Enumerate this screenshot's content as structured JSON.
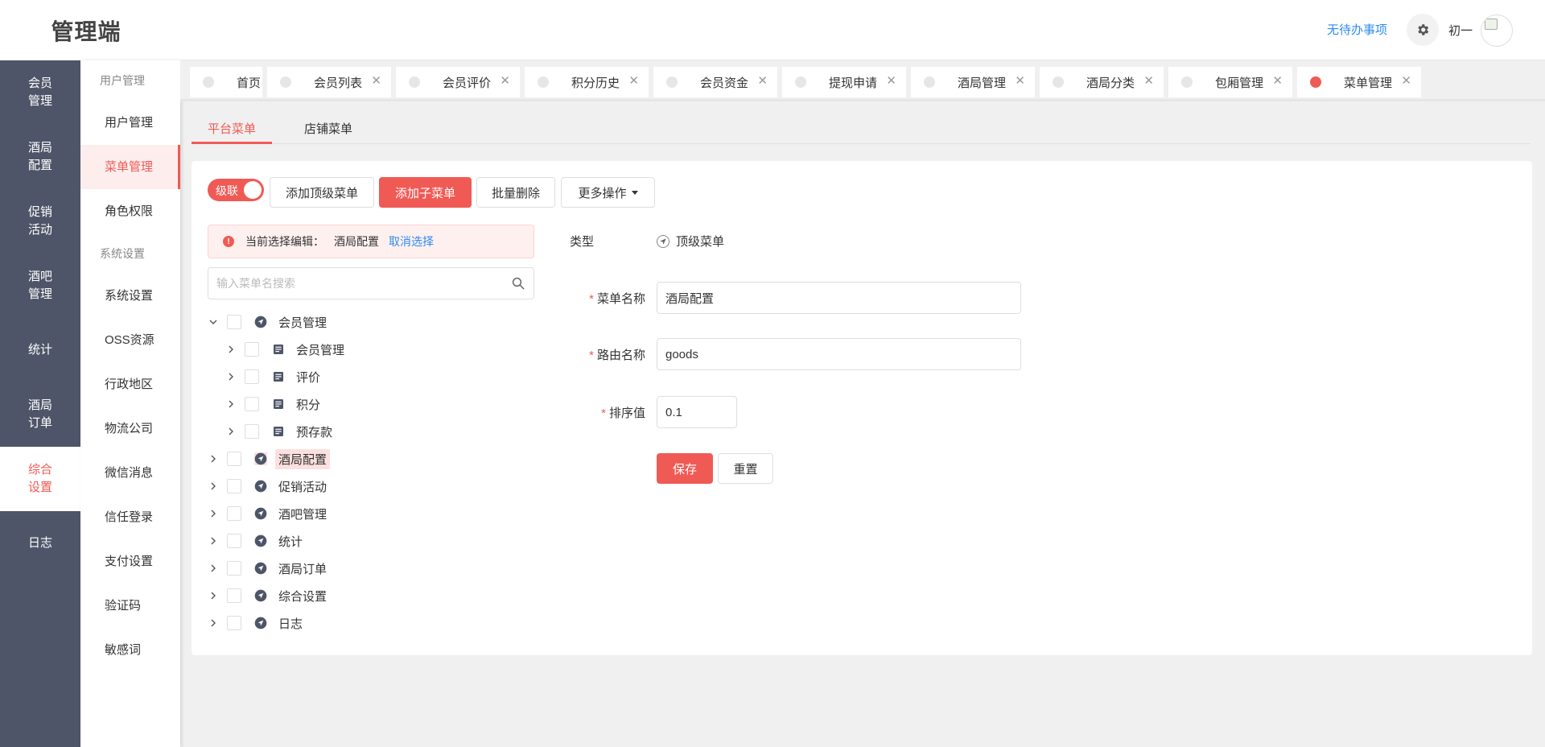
{
  "app": {
    "title": "管理端"
  },
  "nav_primary": [
    {
      "label": "会员管理",
      "active": false
    },
    {
      "label": "酒局配置",
      "active": false
    },
    {
      "label": "促销活动",
      "active": false
    },
    {
      "label": "酒吧管理",
      "active": false
    },
    {
      "label": "统计",
      "active": false
    },
    {
      "label": "酒局订单",
      "active": false
    },
    {
      "label": "综合设置",
      "active": true
    },
    {
      "label": "日志",
      "active": false
    }
  ],
  "nav_secondary": {
    "group_user": "用户管理",
    "user_items": [
      "用户管理",
      "菜单管理",
      "角色权限"
    ],
    "group_system": "系统设置",
    "system_items": [
      "系统设置",
      "OSS资源",
      "行政地区",
      "物流公司",
      "微信消息",
      "信任登录",
      "支付设置",
      "验证码",
      "敏感词"
    ],
    "active": "菜单管理"
  },
  "header": {
    "todo": "无待办事项",
    "username": "初一",
    "gear_icon": "gear-icon"
  },
  "tabs": [
    {
      "label": "首页",
      "closable": false
    },
    {
      "label": "会员列表",
      "closable": true
    },
    {
      "label": "会员评价",
      "closable": true
    },
    {
      "label": "积分历史",
      "closable": true
    },
    {
      "label": "会员资金",
      "closable": true
    },
    {
      "label": "提现申请",
      "closable": true
    },
    {
      "label": "酒局管理",
      "closable": true
    },
    {
      "label": "酒局分类",
      "closable": true
    },
    {
      "label": "包厢管理",
      "closable": true
    },
    {
      "label": "菜单管理",
      "closable": true,
      "active": true
    }
  ],
  "close_glyph": "✕",
  "content_tabs": {
    "platform": "平台菜单",
    "shop": "店铺菜单"
  },
  "toolbar": {
    "switch_label": "级联",
    "add_top": "添加顶级菜单",
    "add_child": "添加子菜单",
    "batch_delete": "批量删除",
    "more": "更多操作"
  },
  "alert": {
    "current_label": "当前选择编辑：",
    "selected": "酒局配置",
    "cancel": "取消选择"
  },
  "search": {
    "placeholder": "输入菜单名搜索"
  },
  "tree": [
    {
      "label": "会员管理",
      "level": 0,
      "expanded": true,
      "icon": "navigation-icon"
    },
    {
      "label": "会员管理",
      "level": 1,
      "expanded": false,
      "icon": "list-icon"
    },
    {
      "label": "评价",
      "level": 1,
      "expanded": false,
      "icon": "list-icon"
    },
    {
      "label": "积分",
      "level": 1,
      "expanded": false,
      "icon": "list-icon"
    },
    {
      "label": "预存款",
      "level": 1,
      "expanded": false,
      "icon": "list-icon"
    },
    {
      "label": "酒局配置",
      "level": 0,
      "expanded": false,
      "icon": "navigation-icon",
      "selected": true
    },
    {
      "label": "促销活动",
      "level": 0,
      "expanded": false,
      "icon": "navigation-icon"
    },
    {
      "label": "酒吧管理",
      "level": 0,
      "expanded": false,
      "icon": "navigation-icon"
    },
    {
      "label": "统计",
      "level": 0,
      "expanded": false,
      "icon": "navigation-icon"
    },
    {
      "label": "酒局订单",
      "level": 0,
      "expanded": false,
      "icon": "navigation-icon"
    },
    {
      "label": "综合设置",
      "level": 0,
      "expanded": false,
      "icon": "navigation-icon"
    },
    {
      "label": "日志",
      "level": 0,
      "expanded": false,
      "icon": "navigation-icon"
    }
  ],
  "form": {
    "type_label": "类型",
    "type_value": "顶级菜单",
    "name_label": "菜单名称",
    "name_value": "酒局配置",
    "route_label": "路由名称",
    "route_value": "goods",
    "sort_label": "排序值",
    "sort_value": "0.1",
    "required_mark": "*",
    "save": "保存",
    "reset": "重置"
  },
  "colors": {
    "accent": "#f05a55",
    "sidebar": "#4e5568",
    "link": "#2d8cf0"
  }
}
